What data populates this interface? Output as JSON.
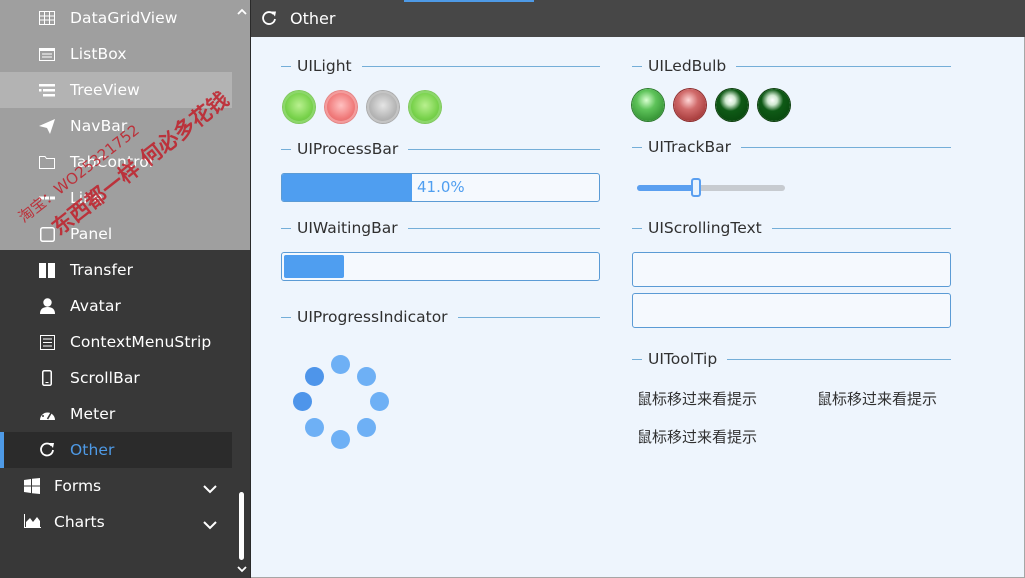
{
  "sidebar": {
    "items": [
      {
        "label": "DataGridView",
        "icon": "grid-icon"
      },
      {
        "label": "ListBox",
        "icon": "listbox-icon"
      },
      {
        "label": "TreeView",
        "icon": "treeview-icon"
      },
      {
        "label": "NavBar",
        "icon": "paper-plane-icon"
      },
      {
        "label": "TabControl",
        "icon": "folder-icon"
      },
      {
        "label": "Line",
        "icon": "line-icon"
      },
      {
        "label": "Panel",
        "icon": "square-icon"
      },
      {
        "label": "Transfer",
        "icon": "columns-icon"
      },
      {
        "label": "Avatar",
        "icon": "user-icon"
      },
      {
        "label": "ContextMenuStrip",
        "icon": "menu-list-icon"
      },
      {
        "label": "ScrollBar",
        "icon": "mobile-icon"
      },
      {
        "label": "Meter",
        "icon": "dashboard-icon"
      },
      {
        "label": "Other",
        "icon": "refresh-icon"
      }
    ],
    "groups": [
      {
        "label": "Forms",
        "icon": "windows-icon"
      },
      {
        "label": "Charts",
        "icon": "area-chart-icon"
      }
    ],
    "hovered": "TreeView",
    "active": "Other"
  },
  "watermark": {
    "line1": "淘宝：WO25321752",
    "line2": "东西都一样 何必多花钱"
  },
  "header": {
    "title": "Other",
    "icon": "refresh-icon"
  },
  "main": {
    "groups": {
      "light": "UILight",
      "process_bar": "UIProcessBar",
      "waiting_bar": "UIWaitingBar",
      "progress_indicator": "UIProgressIndicator",
      "led_bulb": "UILedBulb",
      "track_bar": "UITrackBar",
      "scrolling_text": "UIScrollingText",
      "tooltip": "UIToolTip"
    },
    "lights": [
      "green",
      "red",
      "gray",
      "green"
    ],
    "led_bulbs": [
      "green",
      "red",
      "dark-green",
      "dark-green"
    ],
    "process_bar": {
      "value": 0.41,
      "text": "41.0%"
    },
    "track_bar": {
      "value": 0.4
    },
    "tooltips": {
      "text1": "鼠标移过来看提示",
      "text2": "鼠标移过来看提示",
      "text3": "鼠标移过来看提示"
    },
    "colors": {
      "accent": "#4e9ae6",
      "sidebar_bg": "#383838",
      "main_bg": "#eef5fd"
    }
  }
}
